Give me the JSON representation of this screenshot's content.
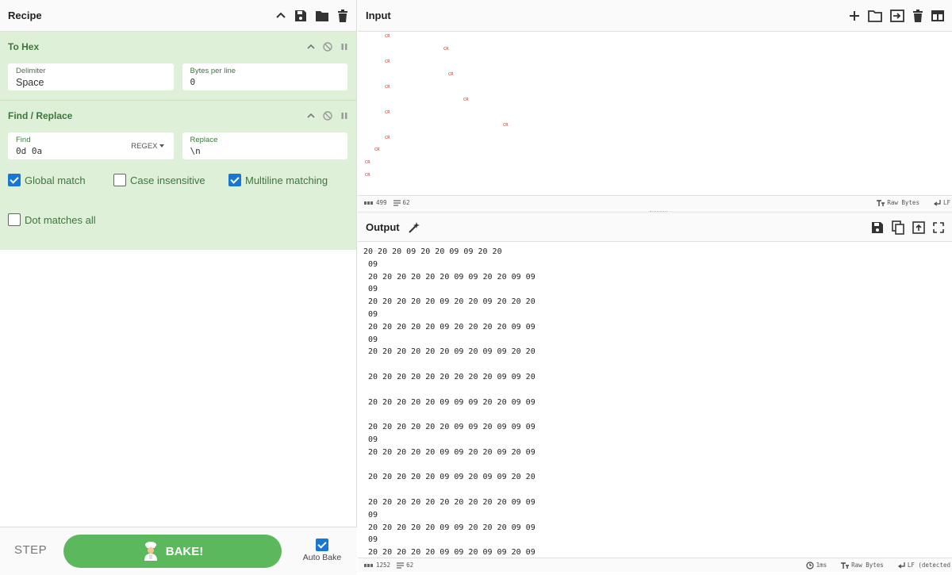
{
  "recipe": {
    "title": "Recipe",
    "header_icons": [
      "chevron-up-icon",
      "save-icon",
      "folder-icon",
      "trash-icon"
    ],
    "operations": [
      {
        "title": "To Hex",
        "fields": [
          {
            "label": "Delimiter",
            "value": "Space"
          },
          {
            "label": "Bytes per line",
            "value": "0"
          }
        ]
      },
      {
        "title": "Find / Replace",
        "find": {
          "label": "Find",
          "value": "0d 0a",
          "mode": "REGEX"
        },
        "replace": {
          "label": "Replace",
          "value": "\\n"
        },
        "checkboxes": [
          {
            "label": "Global match",
            "checked": true
          },
          {
            "label": "Case insensitive",
            "checked": false
          },
          {
            "label": "Multiline matching",
            "checked": true
          },
          {
            "label": "Dot matches all",
            "checked": false
          }
        ]
      }
    ],
    "step_label": "STEP",
    "bake_label": "BAKE!",
    "auto_bake_label": "Auto Bake",
    "auto_bake_checked": true
  },
  "input": {
    "title": "Input",
    "cr_marker": "CR",
    "status": {
      "length": "499",
      "lines": "62",
      "raw_bytes": "Raw Bytes",
      "eol": "LF"
    }
  },
  "output": {
    "title": "Output",
    "lines": [
      "20 20 20 09 20 20 09 09 20 20",
      "09",
      "20 20 20 20 20 20 09 09 20 20 09 09",
      "09",
      "20 20 20 20 20 09 20 20 09 20 20 20",
      "09",
      "20 20 20 20 20 09 20 20 20 20 09 09",
      "09",
      "20 20 20 20 20 20 09 20 09 09 20 20",
      "",
      "20 20 20 20 20 20 20 20 20 09 09 20",
      "",
      "20 20 20 20 20 09 09 09 20 20 09 09",
      "",
      "20 20 20 20 20 20 09 09 20 09 09 09",
      "09",
      "20 20 20 20 20 09 09 20 20 09 20 09",
      "",
      "20 20 20 20 20 09 09 20 09 09 20 20",
      "",
      "20 20 20 20 20 20 20 20 20 20 09 09",
      "09",
      "20 20 20 20 20 09 09 20 20 20 09 09",
      "09",
      "20 20 20 20 20 09 09 20 09 09 20 09"
    ],
    "status": {
      "length": "1252",
      "lines": "62",
      "time": "1ms",
      "raw_bytes": "Raw Bytes",
      "eol": "LF (detected"
    }
  },
  "colors": {
    "accent_green": "#5cb85c",
    "op_bg": "#dff0d8",
    "checkbox_blue": "#1976d2",
    "cr_red": "#d32f2f"
  }
}
